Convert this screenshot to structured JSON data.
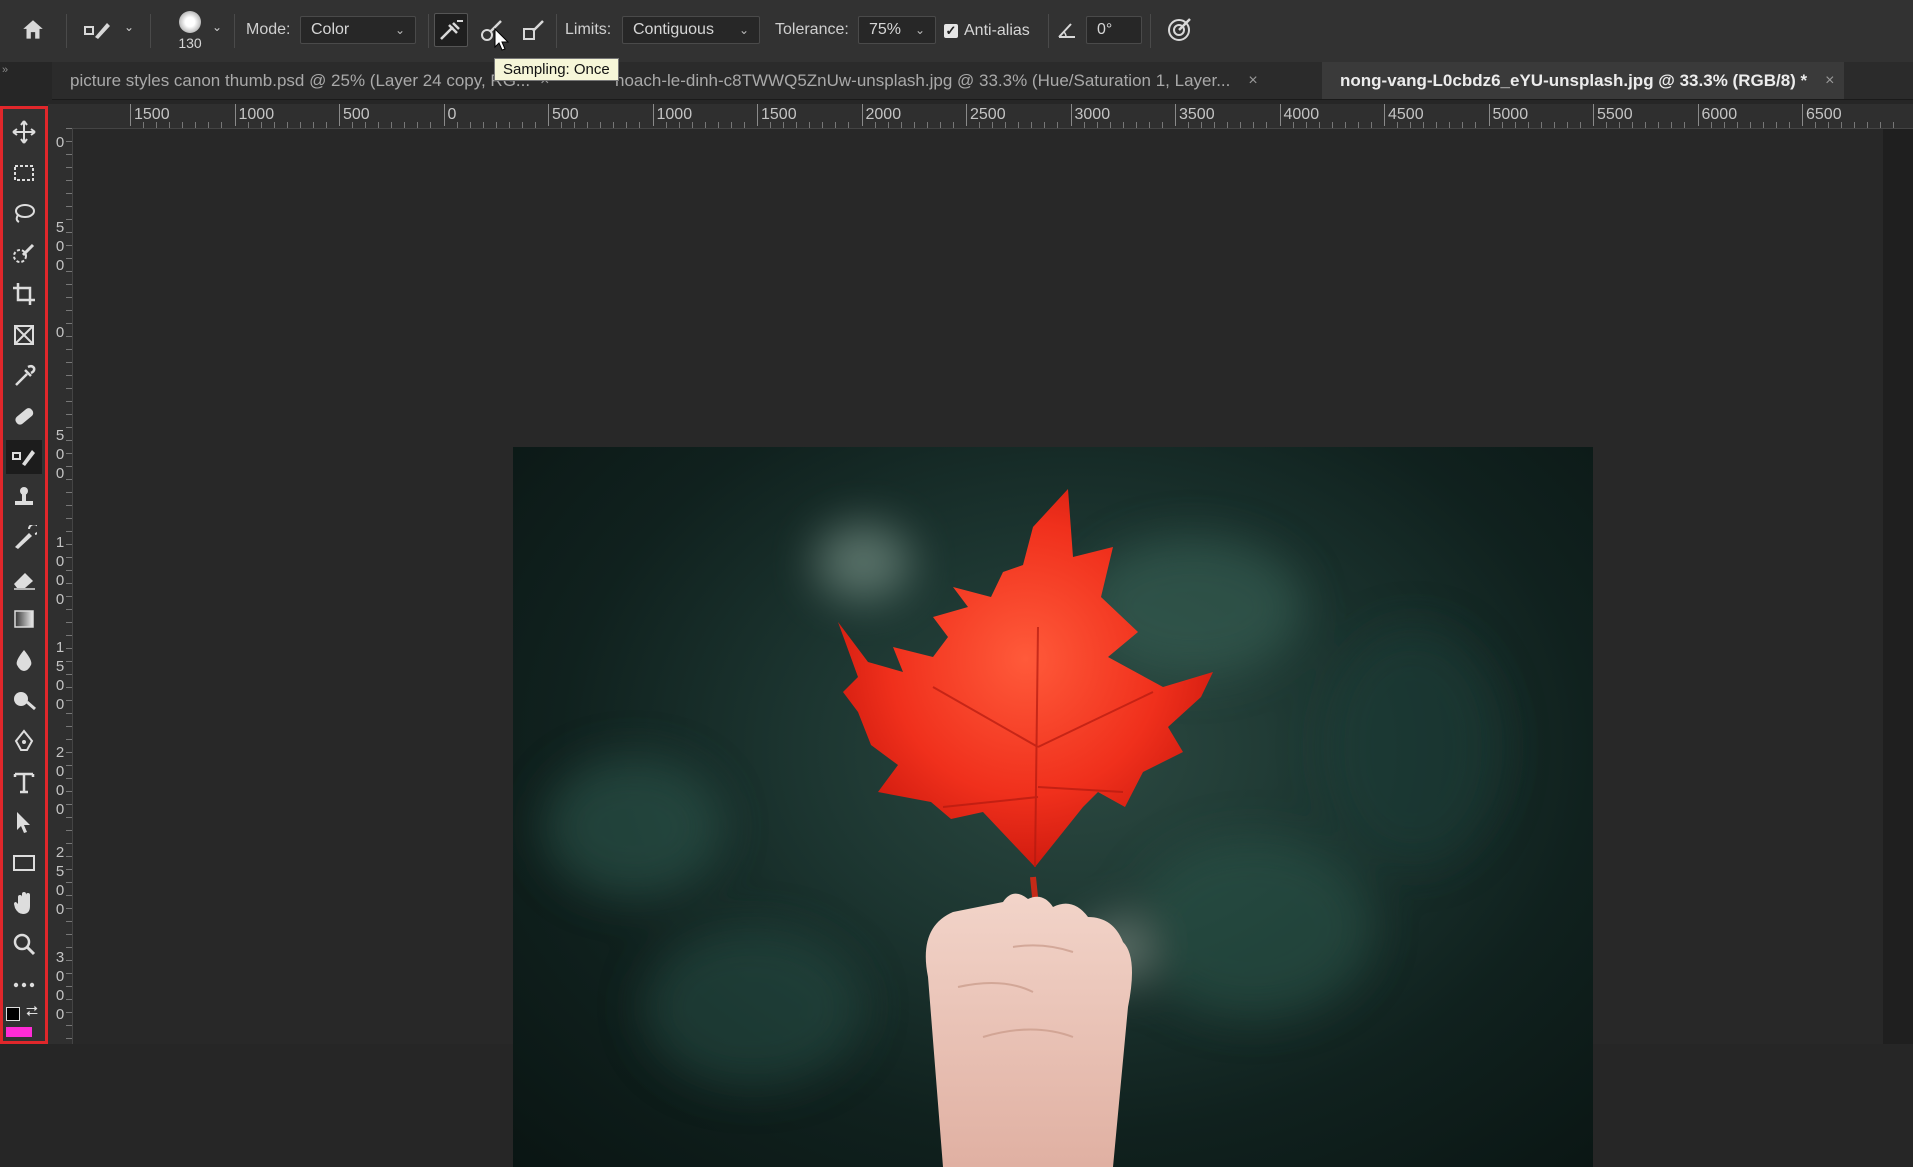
{
  "optionsBar": {
    "brushSize": "130",
    "modeLabel": "Mode:",
    "modeValue": "Color",
    "limitsLabel": "Limits:",
    "limitsValue": "Contiguous",
    "toleranceLabel": "Tolerance:",
    "toleranceValue": "75%",
    "antiAliasLabel": "Anti-alias",
    "antiAliasChecked": true,
    "angleValue": "0°",
    "samplingTooltip": "Sampling: Once"
  },
  "tabs": [
    {
      "label": "picture styles canon thumb.psd @ 25% (Layer 24 copy, RG...",
      "close": "×"
    },
    {
      "label": "hoach-le-dinh-c8TWWQ5ZnUw-unsplash.jpg @ 33.3% (Hue/Saturation 1, Layer...",
      "close": "×"
    },
    {
      "label": "nong-vang-L0cbdz6_eYU-unsplash.jpg @ 33.3% (RGB/8) *",
      "close": "×"
    }
  ],
  "rulers": {
    "horizontal": [
      "1500",
      "1000",
      "500",
      "0",
      "500",
      "1000",
      "1500",
      "2000",
      "2500",
      "3000",
      "3500",
      "4000",
      "4500",
      "5000",
      "5500",
      "6000",
      "6500"
    ],
    "vertical": [
      "0",
      "500",
      "0",
      "500",
      "1000",
      "1500",
      "2000",
      "2500",
      "3000"
    ]
  },
  "tools": [
    {
      "name": "move-tool-icon"
    },
    {
      "name": "marquee-tool-icon"
    },
    {
      "name": "lasso-tool-icon"
    },
    {
      "name": "quick-selection-tool-icon"
    },
    {
      "name": "crop-tool-icon"
    },
    {
      "name": "frame-tool-icon"
    },
    {
      "name": "eyedropper-tool-icon"
    },
    {
      "name": "healing-brush-tool-icon"
    },
    {
      "name": "color-replacement-tool-icon"
    },
    {
      "name": "clone-stamp-tool-icon"
    },
    {
      "name": "history-brush-tool-icon"
    },
    {
      "name": "eraser-tool-icon"
    },
    {
      "name": "gradient-tool-icon"
    },
    {
      "name": "blur-tool-icon"
    },
    {
      "name": "dodge-tool-icon"
    },
    {
      "name": "pen-tool-icon"
    },
    {
      "name": "type-tool-icon"
    },
    {
      "name": "path-selection-tool-icon"
    },
    {
      "name": "rectangle-tool-icon"
    },
    {
      "name": "hand-tool-icon"
    },
    {
      "name": "zoom-tool-icon"
    },
    {
      "name": "more-tools-icon"
    }
  ],
  "colors": {
    "foreground": "#000000",
    "background": "#ff2bd6",
    "highlight": "#e0272b"
  }
}
